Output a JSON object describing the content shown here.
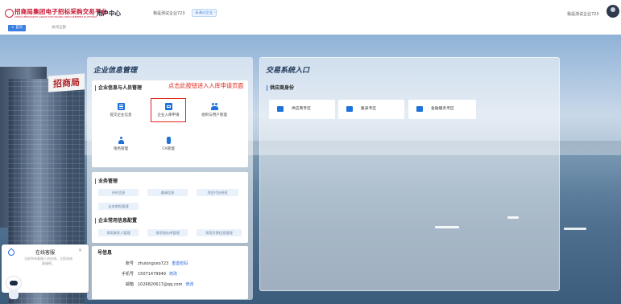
{
  "header": {
    "brand_title": "招商局集团电子招标采购交易平台",
    "brand_subtitle": "CHINA MERCHANTS GROUP ELECTRONIC PROCUREMENT PLATFORM",
    "user_center": "用户中心",
    "company_name": "我是测试企业723",
    "company_badge": "未通过企业",
    "user_name": "我是测试企业723"
  },
  "tabs": {
    "home": "+ 首页",
    "close_all": "关闭全部"
  },
  "backdrop": {
    "sign_text": "招商局"
  },
  "left_panel": {
    "title": "企业信息管理",
    "annotation": "点击此按钮进入入库申请页面",
    "section_info": {
      "title": "企业信息与人员管理",
      "items": [
        {
          "label": "提交企业信息",
          "icon": "document-icon"
        },
        {
          "label": "企业入库申请",
          "icon": "box-icon"
        },
        {
          "label": "组织与用户管理",
          "icon": "users-icon"
        },
        {
          "label": "角色管理",
          "icon": "user-icon"
        },
        {
          "label": "CA管理",
          "icon": "usb-key-icon"
        }
      ]
    },
    "section_business": {
      "title": "业务管理",
      "items": [
        "评价信息",
        "邀请信息",
        "项目代办授权",
        "业务审批管理"
      ]
    },
    "section_common": {
      "title": "企业常用信息配置",
      "items": [
        "常用联系人管理",
        "常用地址库管理",
        "常用开票信息管理"
      ]
    },
    "section_account": {
      "title": "号信息",
      "rows": [
        {
          "key": "账号",
          "value": "zhulongceo723",
          "action": "重置密码"
        },
        {
          "key": "手机号",
          "value": "15071479949",
          "action": "修改"
        },
        {
          "key": "邮箱",
          "value": "1026820617@qq.com",
          "action": "修改"
        }
      ]
    }
  },
  "right_panel": {
    "title": "交易系统入口",
    "section_title": "供应商身份",
    "buttons": [
      {
        "label": "供应商专区",
        "icon": "supplier-icon"
      },
      {
        "label": "集采专区",
        "icon": "cart-icon"
      },
      {
        "label": "金融服务专区",
        "icon": "finance-icon"
      }
    ]
  },
  "chat": {
    "title": "在线客服",
    "subtitle": "当前所有客服人员在线，立即咨询客服吧。"
  }
}
